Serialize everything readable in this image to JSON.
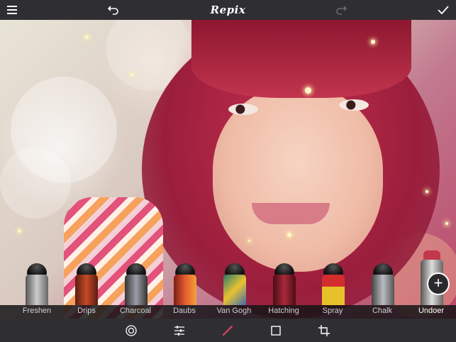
{
  "app": {
    "title": "Repix"
  },
  "toolbar": {
    "menu_icon": "hamburger-menu-icon",
    "undo_icon": "undo-arrow-icon",
    "redo_icon": "redo-arrow-icon",
    "confirm_icon": "checkmark-icon"
  },
  "brushes": {
    "items": [
      {
        "label": "Freshen",
        "color": "#8a8d92"
      },
      {
        "label": "Drips",
        "color": "#b2381d"
      },
      {
        "label": "Charcoal",
        "color": "#5a5e68"
      },
      {
        "label": "Daubs",
        "color": "#d6442b"
      },
      {
        "label": "Van Gogh",
        "color": "#e2b428"
      },
      {
        "label": "Hatching",
        "color": "#8c1f2c"
      },
      {
        "label": "Spray",
        "color": "#c92a2a"
      },
      {
        "label": "Chalk",
        "color": "#7d828c"
      },
      {
        "label": "Undoer",
        "color": "#c2384b"
      }
    ],
    "selected": "Undoer",
    "add_icon": "plus-circle-icon"
  },
  "bottom_tools": [
    {
      "name": "circle-target-icon"
    },
    {
      "name": "adjust-sliders-icon"
    },
    {
      "name": "brush-icon"
    },
    {
      "name": "frame-square-icon"
    },
    {
      "name": "crop-icon"
    }
  ],
  "colors": {
    "accent": "#e0455a",
    "bar": "#2f2e33"
  }
}
